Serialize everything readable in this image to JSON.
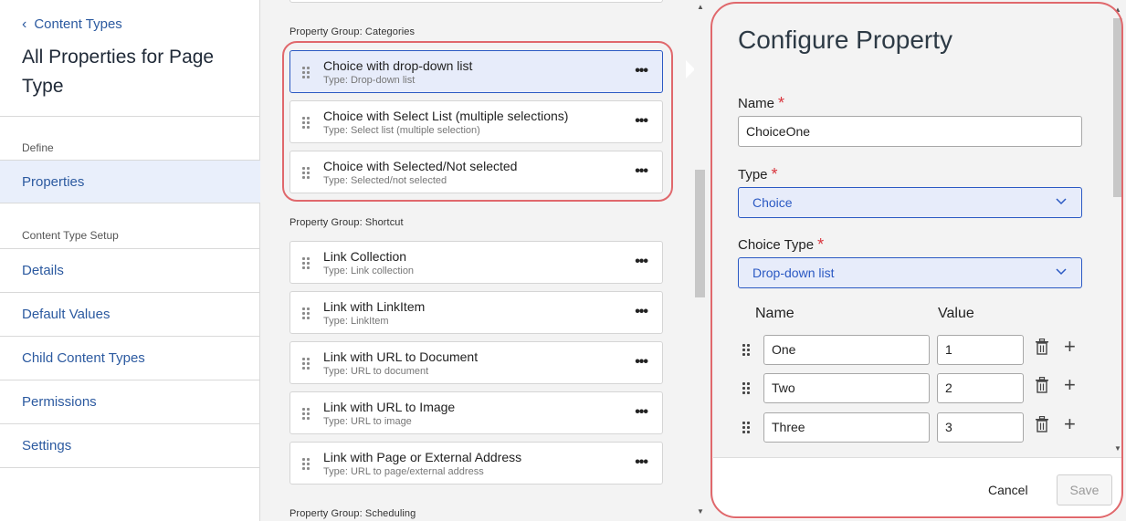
{
  "sidebar": {
    "back_label": "Content Types",
    "title": "All Properties for Page Type",
    "section_define": "Define",
    "items_define": [
      {
        "label": "Properties",
        "active": true
      }
    ],
    "section_setup": "Content Type Setup",
    "items_setup": [
      {
        "label": "Details"
      },
      {
        "label": "Default Values"
      },
      {
        "label": "Child Content Types"
      },
      {
        "label": "Permissions"
      },
      {
        "label": "Settings"
      }
    ]
  },
  "groups": [
    {
      "label": "Property Group: Categories",
      "properties": [
        {
          "name": "Choice with drop-down list",
          "type": "Type: Drop-down list",
          "selected": true
        },
        {
          "name": "Choice with Select List (multiple selections)",
          "type": "Type: Select list (multiple selection)"
        },
        {
          "name": "Choice with Selected/Not selected",
          "type": "Type: Selected/not selected"
        }
      ]
    },
    {
      "label": "Property Group: Shortcut",
      "properties": [
        {
          "name": "Link Collection",
          "type": "Type: Link collection"
        },
        {
          "name": "Link with LinkItem",
          "type": "Type: LinkItem"
        },
        {
          "name": "Link with URL to Document",
          "type": "Type: URL to document"
        },
        {
          "name": "Link with URL to Image",
          "type": "Type: URL to image"
        },
        {
          "name": "Link with Page or External Address",
          "type": "Type: URL to page/external address"
        }
      ]
    },
    {
      "label": "Property Group: Scheduling",
      "properties": []
    }
  ],
  "panel": {
    "title": "Configure Property",
    "name_label": "Name",
    "name_value": "ChoiceOne",
    "type_label": "Type",
    "type_value": "Choice",
    "choice_type_label": "Choice Type",
    "choice_type_value": "Drop-down list",
    "required_mark": "*",
    "options_header_name": "Name",
    "options_header_value": "Value",
    "options": [
      {
        "name": "One",
        "value": "1"
      },
      {
        "name": "Two",
        "value": "2"
      },
      {
        "name": "Three",
        "value": "3"
      }
    ],
    "cancel_label": "Cancel",
    "save_label": "Save"
  },
  "colors": {
    "accent": "#2b59c3",
    "link": "#2c5aa0",
    "highlight_ring": "#e0686c",
    "required": "#d9363e"
  }
}
